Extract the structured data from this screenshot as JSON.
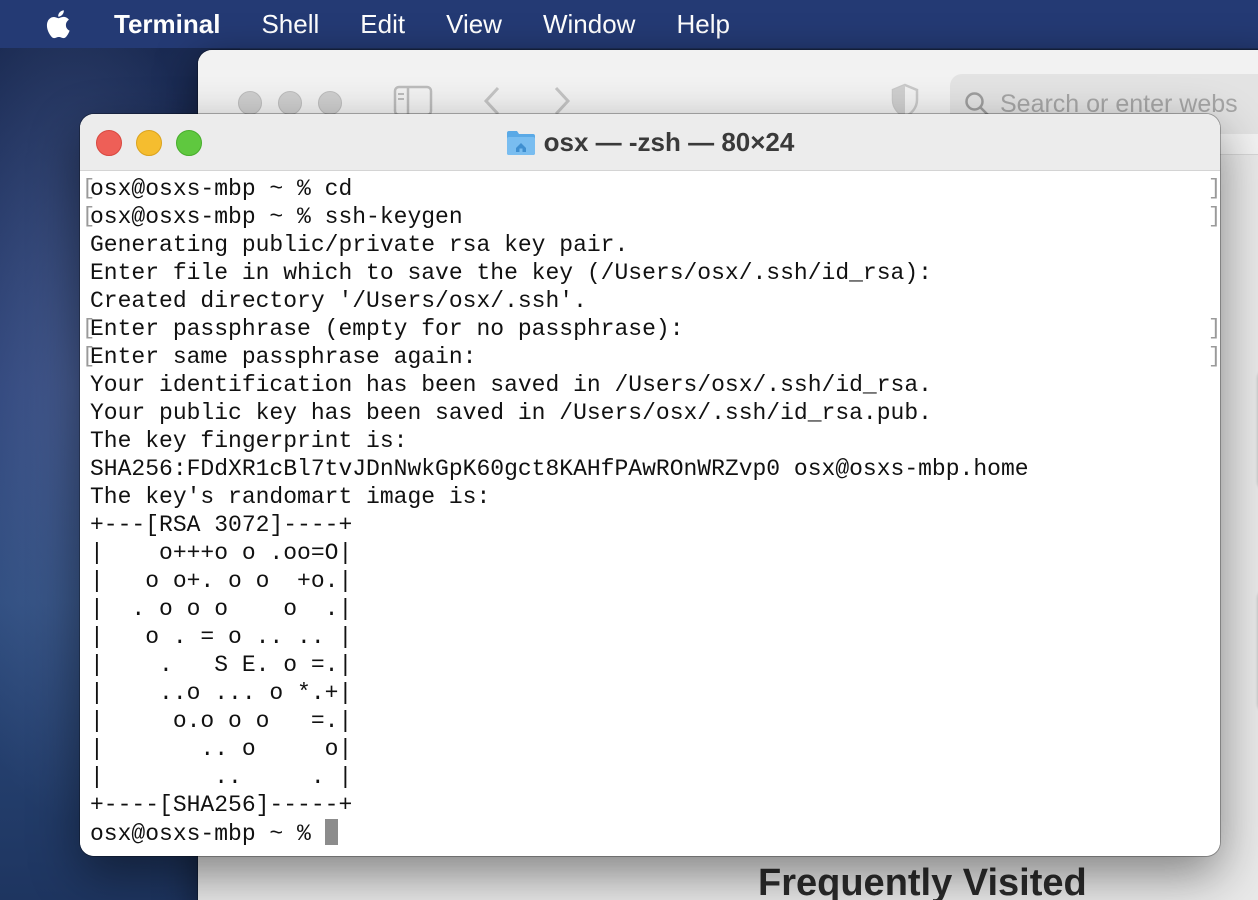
{
  "menubar": {
    "apple_icon": "apple-logo-icon",
    "app_name": "Terminal",
    "items": [
      "Shell",
      "Edit",
      "View",
      "Window",
      "Help"
    ]
  },
  "browser": {
    "search_placeholder": "Search or enter webs",
    "section_title": "Frequently Visited",
    "icons": [
      "sidebar-icon",
      "back-icon",
      "forward-icon",
      "shield-icon",
      "search-icon"
    ]
  },
  "terminal": {
    "title": "osx — -zsh — 80×24",
    "colors": {
      "close": "#ee5f57",
      "minimize": "#f5bd2f",
      "zoom": "#5fc83f"
    },
    "lines": [
      "osx@osxs-mbp ~ % cd",
      "osx@osxs-mbp ~ % ssh-keygen",
      "Generating public/private rsa key pair.",
      "Enter file in which to save the key (/Users/osx/.ssh/id_rsa):",
      "Created directory '/Users/osx/.ssh'.",
      "Enter passphrase (empty for no passphrase):",
      "Enter same passphrase again:",
      "Your identification has been saved in /Users/osx/.ssh/id_rsa.",
      "Your public key has been saved in /Users/osx/.ssh/id_rsa.pub.",
      "The key fingerprint is:",
      "SHA256:FDdXR1cBl7tvJDnNwkGpK60gct8KAHfPAwROnWRZvp0 osx@osxs-mbp.home",
      "The key's randomart image is:",
      "+---[RSA 3072]----+",
      "|    o+++o o .oo=O|",
      "|   o o+. o o  +o.|",
      "|  . o o o    o  .|",
      "|   o . = o .. .. |",
      "|    .   S E. o =.|",
      "|    ..o ... o *.+|",
      "|     o.o o o   =.|",
      "|       .. o     o|",
      "|        ..     . |",
      "+----[SHA256]-----+"
    ],
    "prompt": "osx@osxs-mbp ~ % ",
    "marked_lines": [
      0,
      1,
      5,
      6
    ]
  }
}
